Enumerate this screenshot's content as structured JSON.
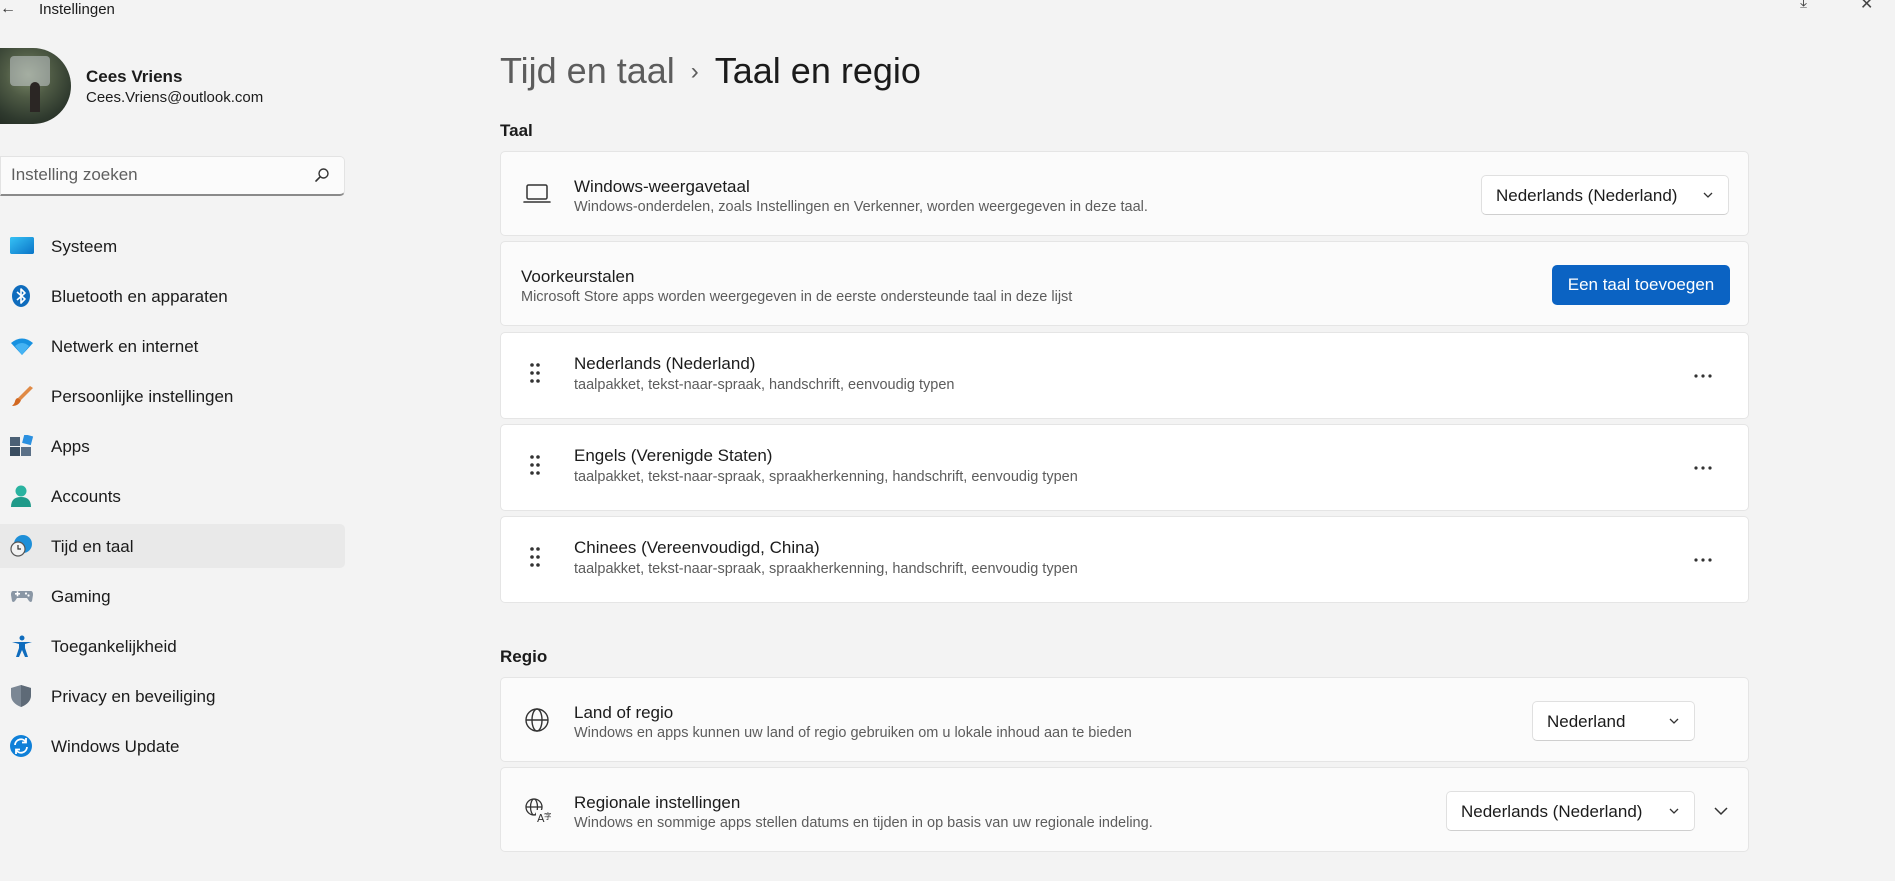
{
  "window": {
    "title": "Instellingen",
    "back_icon": "←",
    "controls": [
      "⤓",
      "✕"
    ]
  },
  "profile": {
    "name": "Cees Vriens",
    "email": "Cees.Vriens@outlook.com"
  },
  "search": {
    "placeholder": "Instelling zoeken"
  },
  "sidebar": {
    "items": [
      {
        "label": "Systeem",
        "icon": "system-icon"
      },
      {
        "label": "Bluetooth en apparaten",
        "icon": "bluetooth-icon"
      },
      {
        "label": "Netwerk en internet",
        "icon": "wifi-icon"
      },
      {
        "label": "Persoonlijke instellingen",
        "icon": "brush-icon"
      },
      {
        "label": "Apps",
        "icon": "apps-icon"
      },
      {
        "label": "Accounts",
        "icon": "accounts-icon"
      },
      {
        "label": "Tijd en taal",
        "icon": "time-language-icon",
        "active": true
      },
      {
        "label": "Gaming",
        "icon": "gamepad-icon"
      },
      {
        "label": "Toegankelijkheid",
        "icon": "accessibility-icon"
      },
      {
        "label": "Privacy en beveiliging",
        "icon": "shield-icon"
      },
      {
        "label": "Windows Update",
        "icon": "update-icon"
      }
    ]
  },
  "breadcrumb": {
    "parent": "Tijd en taal",
    "separator": "›",
    "current": "Taal en regio"
  },
  "taal": {
    "section_title": "Taal",
    "display_language": {
      "title": "Windows-weergavetaal",
      "description": "Windows-onderdelen, zoals Instellingen en Verkenner, worden weergegeven in deze taal.",
      "value": "Nederlands (Nederland)"
    },
    "preferred": {
      "title": "Voorkeurstalen",
      "description": "Microsoft Store apps worden weergegeven in de eerste ondersteunde taal in deze lijst",
      "button": "Een taal toevoegen"
    },
    "languages": [
      {
        "name": "Nederlands (Nederland)",
        "features": "taalpakket, tekst-naar-spraak, handschrift, eenvoudig typen"
      },
      {
        "name": "Engels (Verenigde Staten)",
        "features": "taalpakket, tekst-naar-spraak, spraakherkenning, handschrift, eenvoudig typen"
      },
      {
        "name": "Chinees (Vereenvoudigd, China)",
        "features": "taalpakket, tekst-naar-spraak, spraakherkenning, handschrift, eenvoudig typen"
      }
    ],
    "more_icon": "⋯"
  },
  "regio": {
    "section_title": "Regio",
    "country": {
      "title": "Land of regio",
      "description": "Windows en apps kunnen uw land of regio gebruiken om u lokale inhoud aan te bieden",
      "value": "Nederland"
    },
    "regional_format": {
      "title": "Regionale instellingen",
      "description": "Windows en sommige apps stellen datums en tijden in op basis van uw regionale indeling.",
      "value": "Nederlands (Nederland)"
    }
  },
  "colors": {
    "accent": "#0b63c3",
    "background": "#f3f3f3",
    "card": "#fbfbfb"
  }
}
